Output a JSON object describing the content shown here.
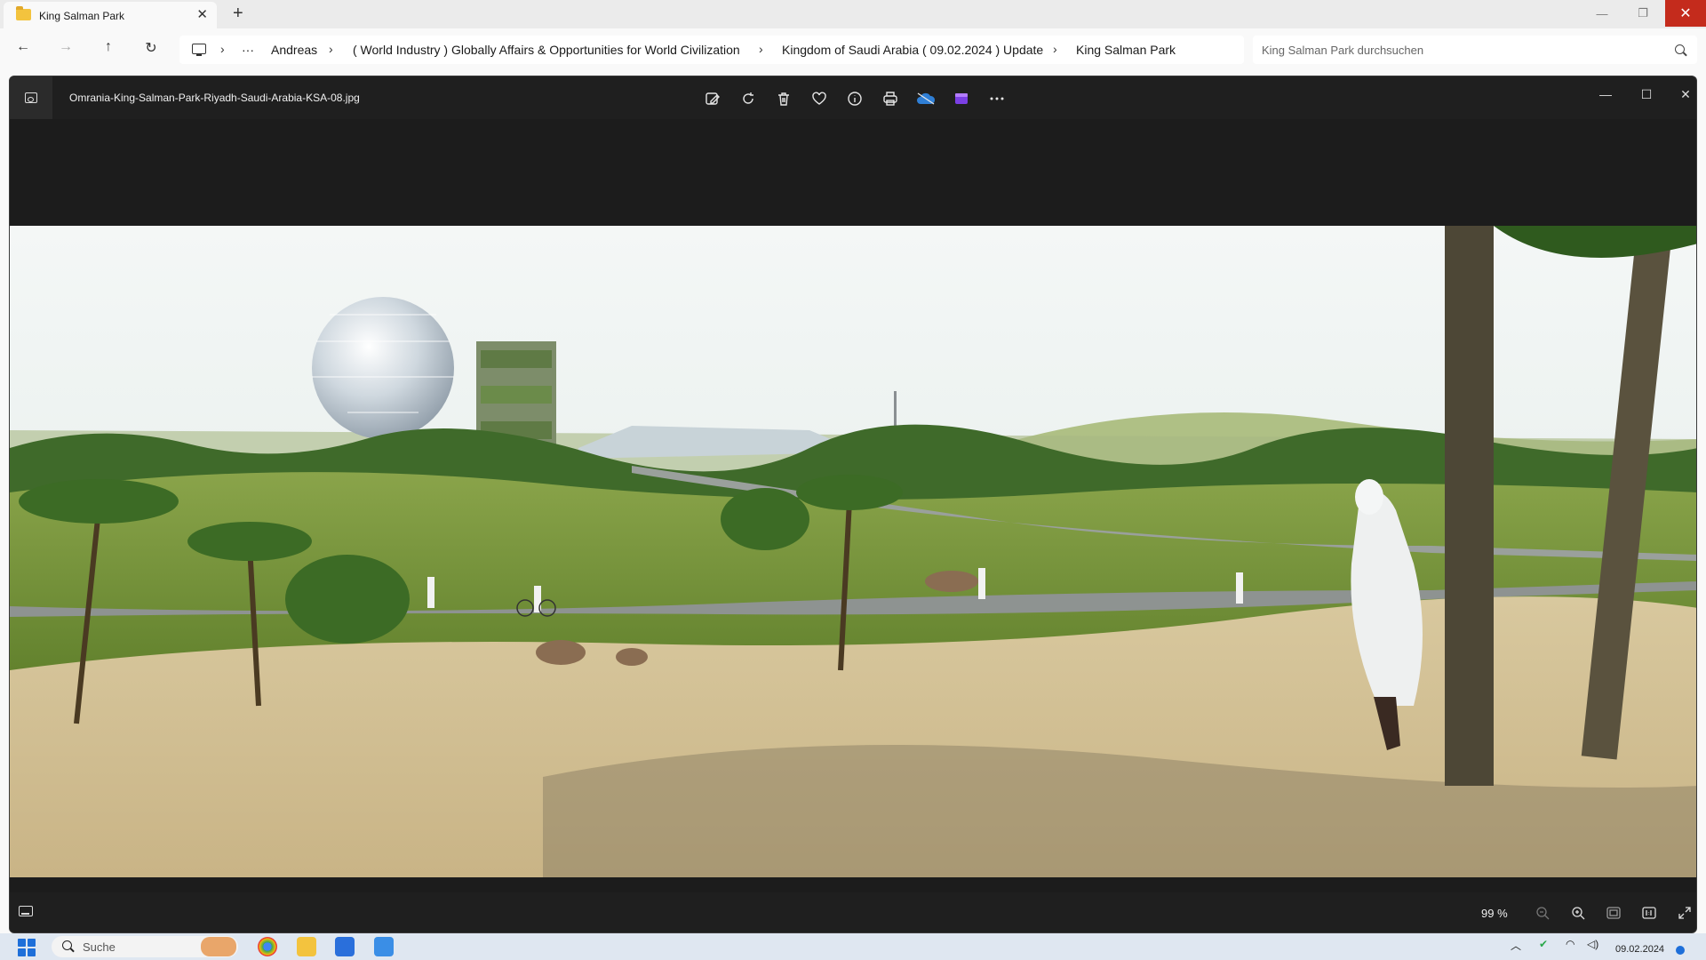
{
  "explorer": {
    "tab_title": "King Salman Park",
    "tab_close": "✕",
    "new_tab": "+",
    "window_controls": {
      "minimize": "—",
      "maximize": "❐",
      "close": "✕"
    },
    "nav": {
      "back": "←",
      "forward": "→",
      "up": "↑",
      "refresh": "↻",
      "more": "···"
    },
    "breadcrumbs": [
      "Andreas",
      "( World Industry ) Globally Affairs & Opportunities for World Civilization",
      "Kingdom of Saudi Arabia ( 09.02.2024 ) Update",
      "King Salman Park"
    ],
    "search_placeholder": "King Salman Park durchsuchen"
  },
  "viewer": {
    "file_name": "Omrania-King-Salman-Park-Riyadh-Saudi-Arabia-KSA-08.jpg",
    "toolbar": [
      "edit-image",
      "rotate",
      "delete",
      "favorite",
      "file-info",
      "print",
      "onedrive",
      "clipchamp",
      "more"
    ],
    "zoom_label": "99 %",
    "window_controls": {
      "minimize": "—",
      "maximize": "☐",
      "close": "✕"
    }
  },
  "taskbar": {
    "search_label": "Suche",
    "date": "09.02.2024"
  },
  "colors": {
    "viewer_bg": "#1f1f1f",
    "accent": "#1e6fd9",
    "close_red": "#c42b1c"
  }
}
